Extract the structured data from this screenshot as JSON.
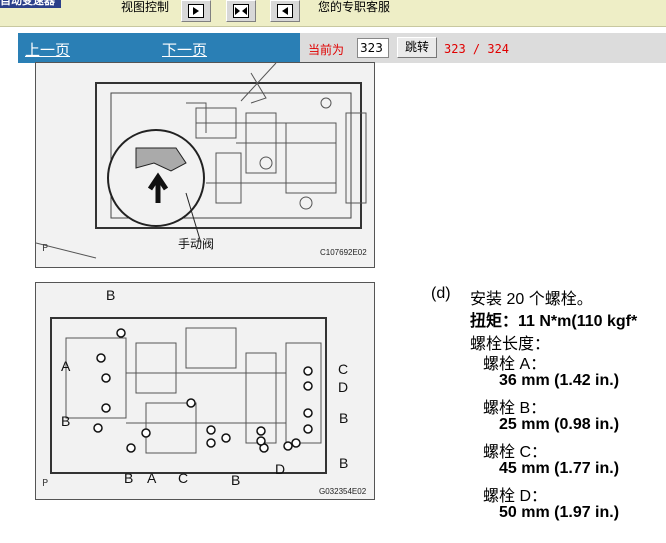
{
  "topbar": {
    "brand_title": "自动变速器",
    "view_control_label": "视图控制",
    "view_buttons": [
      {
        "name": "next-view-button",
        "icon": "arrow-right-icon"
      },
      {
        "name": "fit-view-button",
        "icon": "arrows-inward-icon"
      },
      {
        "name": "prev-view-button",
        "icon": "arrow-left-icon"
      }
    ],
    "service_text": "您的专职客服"
  },
  "nav": {
    "prev_label": "上一页",
    "next_label": "下一页",
    "current_label": "当前为",
    "page_value": "323",
    "jump_label": "跳转",
    "page_info": "323 / 324"
  },
  "figure1": {
    "valve_label": "手动阀",
    "code": "C107692E02",
    "corner_label": "P"
  },
  "figure2": {
    "code": "G032354E02",
    "corner_label": "P",
    "callouts": {
      "b_top": "B",
      "a_left": "A",
      "b_left": "B",
      "b_bottom": "B",
      "a_bottom": "A",
      "c_bottom": "C",
      "b_mid": "B",
      "d_mid": "D",
      "c_right": "C",
      "d_right": "D",
      "b_right1": "B",
      "b_right2": "B"
    }
  },
  "instructions": {
    "step": "(d)",
    "title": "安装 20 个螺栓。",
    "torque": "扭矩：11 N*m(110 kgf*",
    "length_heading": "螺栓长度：",
    "bolts": [
      {
        "label": "螺栓 A：",
        "value": "36 mm (1.42 in.)"
      },
      {
        "label": "螺栓 B：",
        "value": "25 mm (0.98 in.)"
      },
      {
        "label": "螺栓 C：",
        "value": "45 mm (1.77 in.)"
      },
      {
        "label": "螺栓 D：",
        "value": "50 mm (1.97 in.)"
      }
    ]
  }
}
